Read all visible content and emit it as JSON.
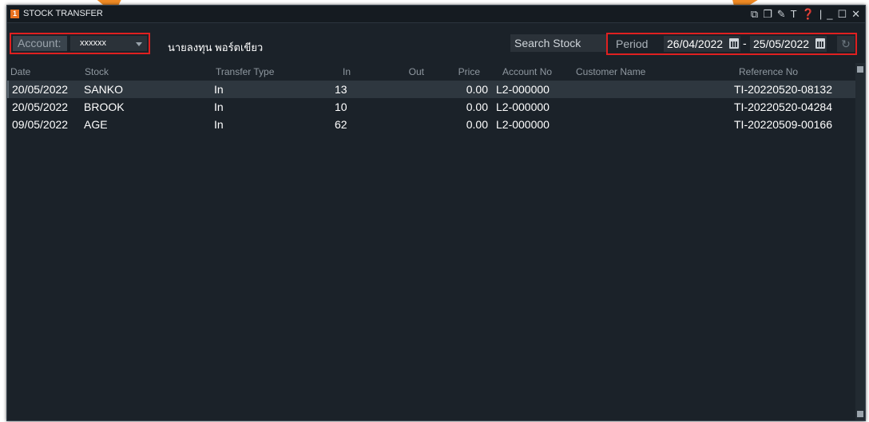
{
  "window": {
    "number": "1",
    "title": "STOCK TRANSFER",
    "icons": [
      "external-link-icon",
      "restore-icon",
      "pin-icon",
      "font-icon",
      "help-icon",
      "minimize-icon",
      "maximize-icon",
      "close-icon"
    ]
  },
  "toolbar": {
    "account_label": "Account:",
    "account_value": "xxxxxx",
    "account_name": "นายลงทุน พอร์ตเขียว",
    "search_stock": "Search Stock",
    "period_label": "Period",
    "date_from": "26/04/2022",
    "date_separator": "-",
    "date_to": "25/05/2022"
  },
  "table": {
    "headers": [
      "Date",
      "Stock",
      "Transfer Type",
      "In",
      "Out",
      "Price",
      "Account No",
      "Customer Name",
      "Reference No"
    ],
    "rows": [
      {
        "date": "20/05/2022",
        "stock": "SANKO",
        "type": "In",
        "in": "13",
        "out": "",
        "price": "0.00",
        "account": "L2-000000",
        "customer": "",
        "ref": "TI-20220520-08132"
      },
      {
        "date": "20/05/2022",
        "stock": "BROOK",
        "type": "In",
        "in": "10",
        "out": "",
        "price": "0.00",
        "account": "L2-000000",
        "customer": "",
        "ref": "TI-20220520-04284"
      },
      {
        "date": "09/05/2022",
        "stock": "AGE",
        "type": "In",
        "in": "62",
        "out": "",
        "price": "0.00",
        "account": "L2-000000",
        "customer": "",
        "ref": "TI-20220509-00166"
      }
    ]
  },
  "colors": {
    "background": "#1b2229",
    "highlight_border": "#e02020",
    "annotation_arrow": "#f08a24",
    "title_badge": "#e8701e"
  }
}
